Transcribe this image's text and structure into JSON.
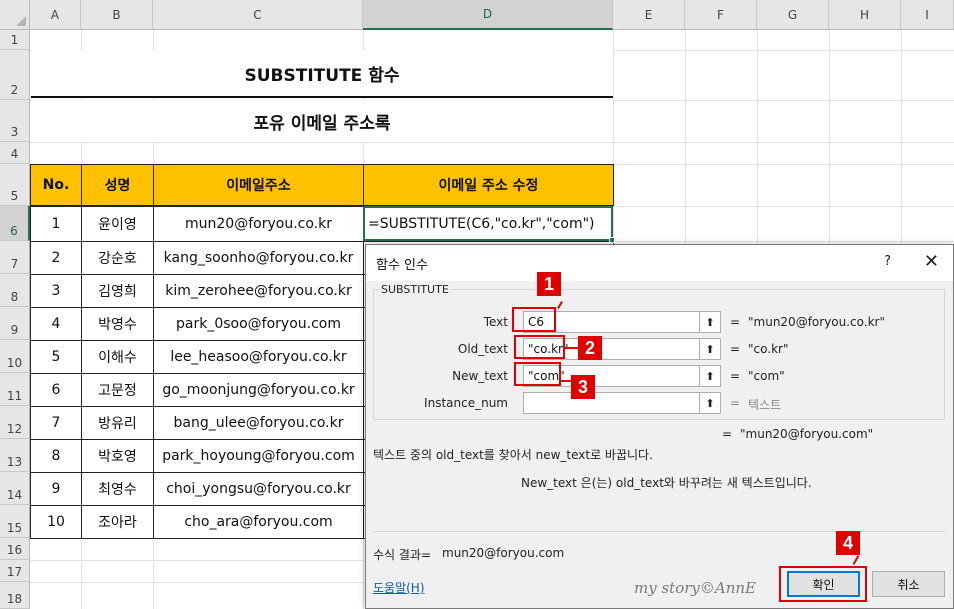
{
  "columns": [
    "A",
    "B",
    "C",
    "D",
    "E",
    "F",
    "G",
    "H",
    "I"
  ],
  "rows": [
    "1",
    "2",
    "3",
    "4",
    "5",
    "6",
    "7",
    "8",
    "9",
    "10",
    "11",
    "12",
    "13",
    "14",
    "15",
    "16",
    "17",
    "18"
  ],
  "sheet": {
    "title": "SUBSTITUTE 함수",
    "subtitle": "포유 이메일 주소록",
    "headers": [
      "No.",
      "성명",
      "이메일주소",
      "이메일 주소 수정"
    ],
    "data": [
      [
        "1",
        "윤이영",
        "mun20@foryou.co.kr"
      ],
      [
        "2",
        "강순호",
        "kang_soonho@foryou.co.kr"
      ],
      [
        "3",
        "김영희",
        "kim_zerohee@foryou.co.kr"
      ],
      [
        "4",
        "박영수",
        "park_0soo@foryou.com"
      ],
      [
        "5",
        "이해수",
        "lee_heasoo@foryou.co.kr"
      ],
      [
        "6",
        "고문정",
        "go_moonjung@foryou.co.kr"
      ],
      [
        "7",
        "방유리",
        "bang_ulee@foryou.co.kr"
      ],
      [
        "8",
        "박호영",
        "park_hoyoung@foryou.com"
      ],
      [
        "9",
        "최영수",
        "choi_yongsu@foryou.co.kr"
      ],
      [
        "10",
        "조아라",
        "cho_ara@foryou.com"
      ]
    ],
    "formula": "=SUBSTITUTE(C6,\"co.kr\",\"com\")"
  },
  "dialog": {
    "title": "함수 인수",
    "help": "?",
    "close": "✕",
    "function_name": "SUBSTITUTE",
    "args": [
      {
        "label": "Text",
        "value": "C6",
        "result": "\"mun20@foryou.co.kr\""
      },
      {
        "label": "Old_text",
        "value": "\"co.kr\"",
        "result": "\"co.kr\""
      },
      {
        "label": "New_text",
        "value": "\"com\"",
        "result": "\"com\""
      },
      {
        "label": "Instance_num",
        "value": "",
        "result": "텍스트"
      }
    ],
    "eq": "=",
    "total_result": "\"mun20@foryou.com\"",
    "description": "텍스트 중의 old_text를 찾아서 new_text로 바꿉니다.",
    "arg_description": "New_text  은(는) old_text와 바꾸려는 새 텍스트입니다.",
    "formula_result_label": "수식 결과=",
    "formula_result_value": "mun20@foryou.com",
    "help_link": "도움말(H)",
    "watermark": "my story©AnnE",
    "ok": "확인",
    "cancel": "취소"
  },
  "annotations": [
    "1",
    "2",
    "3",
    "4"
  ],
  "colors": {
    "accent": "#ffc000",
    "marker": "#e00000",
    "excel_green": "#217346"
  }
}
